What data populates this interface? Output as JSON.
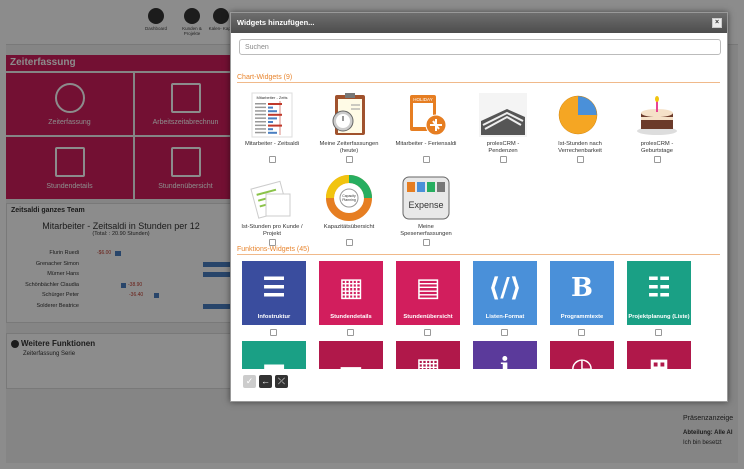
{
  "background": {
    "nav": [
      {
        "label": "Dashboard"
      },
      {
        "label": "Kunden &\nProjekte"
      },
      {
        "label": "Kalen-\nKapa"
      }
    ],
    "section_title": "Zeiterfassung",
    "tiles": [
      {
        "label": "Zeiterfassung"
      },
      {
        "label": "Arbeitszeitabrechnun"
      },
      {
        "label": "Stundendetails"
      },
      {
        "label": "Stundenübersicht"
      }
    ],
    "team_box": {
      "title": "Zeitsaldi ganzes Team",
      "chart_title": "Mitarbeiter - Zeitsaldi in Stunden per 12",
      "chart_sub": "(Total: : 20.90 Stunden)",
      "rows": [
        {
          "name": "Flurin Ruedi",
          "value": "-$6.00"
        },
        {
          "name": "Grenacher Simon",
          "value": ""
        },
        {
          "name": "Mürner Hans",
          "value": ""
        },
        {
          "name": "Schönbächler Claudia",
          "value": "-38.90"
        },
        {
          "name": "Schürger Peter",
          "value": "-36.40"
        },
        {
          "name": "Solderer Beatrice",
          "value": ""
        }
      ]
    },
    "weitere": {
      "title": "Weitere Funktionen",
      "item": "Zeiterfassung Serie"
    },
    "right": {
      "presence": "Präsenzanzeige",
      "dept": "Abteilung: Alle Al",
      "cb": "Ich bin besetzt"
    }
  },
  "dialog": {
    "title": "Widgets hinzufügen...",
    "close": "×",
    "search_placeholder": "Suchen",
    "chart_category": "Chart-Widgets (9)",
    "chart_widgets": [
      {
        "label": "Mitarbeiter - Zeitsaldi",
        "thumb": "bar-chart"
      },
      {
        "label": "Meine Zeiterfassungen (heute)",
        "thumb": "stopwatch-clipboard"
      },
      {
        "label": "Mitarbeiter - Feriensaldi",
        "thumb": "holiday-airplane"
      },
      {
        "label": "prolesCRM - Pendenzen",
        "thumb": "documents"
      },
      {
        "label": "Ist-Stunden nach Verrechenbarkeit",
        "thumb": "pie-chart"
      },
      {
        "label": "prolesCRM - Geburtstage",
        "thumb": "birthday-cake"
      },
      {
        "label": "Ist-Stunden pro Kunde / Projekt",
        "thumb": "documents-green"
      },
      {
        "label": "Kapazitätsübersicht",
        "thumb": "capacity-cycle"
      },
      {
        "label": "Meine Spesenerfassungen",
        "thumb": "expense"
      }
    ],
    "function_category": "Funktions-Widgets (45)",
    "function_widgets": [
      {
        "label": "Infostruktur",
        "color": "#3a4d9e",
        "icon": "stack-icon"
      },
      {
        "label": "Stundendetails",
        "color": "#d21e5d",
        "icon": "calculator-icon"
      },
      {
        "label": "Stundenübersicht",
        "color": "#d21e5d",
        "icon": "clock-sheet-icon"
      },
      {
        "label": "Listen-Format",
        "color": "#4a90d9",
        "icon": "code-file-icon"
      },
      {
        "label": "Programmtexte",
        "color": "#4a90d9",
        "icon": "bold-b-icon"
      },
      {
        "label": "Projektplanung (Liste)",
        "color": "#1aa085",
        "icon": "tree-list-icon"
      },
      {
        "label": "",
        "color": "#1aa085",
        "icon": "toolbox-icon"
      },
      {
        "label": "",
        "color": "#b0184a",
        "icon": "car-icon"
      },
      {
        "label": "",
        "color": "#b0184a",
        "icon": "calculator-car-icon"
      },
      {
        "label": "",
        "color": "#5b3a9b",
        "icon": "info-icon"
      },
      {
        "label": "",
        "color": "#b0184a",
        "icon": "clock-icon"
      },
      {
        "label": "",
        "color": "#b0184a",
        "icon": "cart-icon"
      }
    ],
    "bottom_buttons": [
      {
        "icon": "check-icon"
      },
      {
        "icon": "arrow-left-icon"
      },
      {
        "icon": "collapse-icon"
      }
    ]
  }
}
